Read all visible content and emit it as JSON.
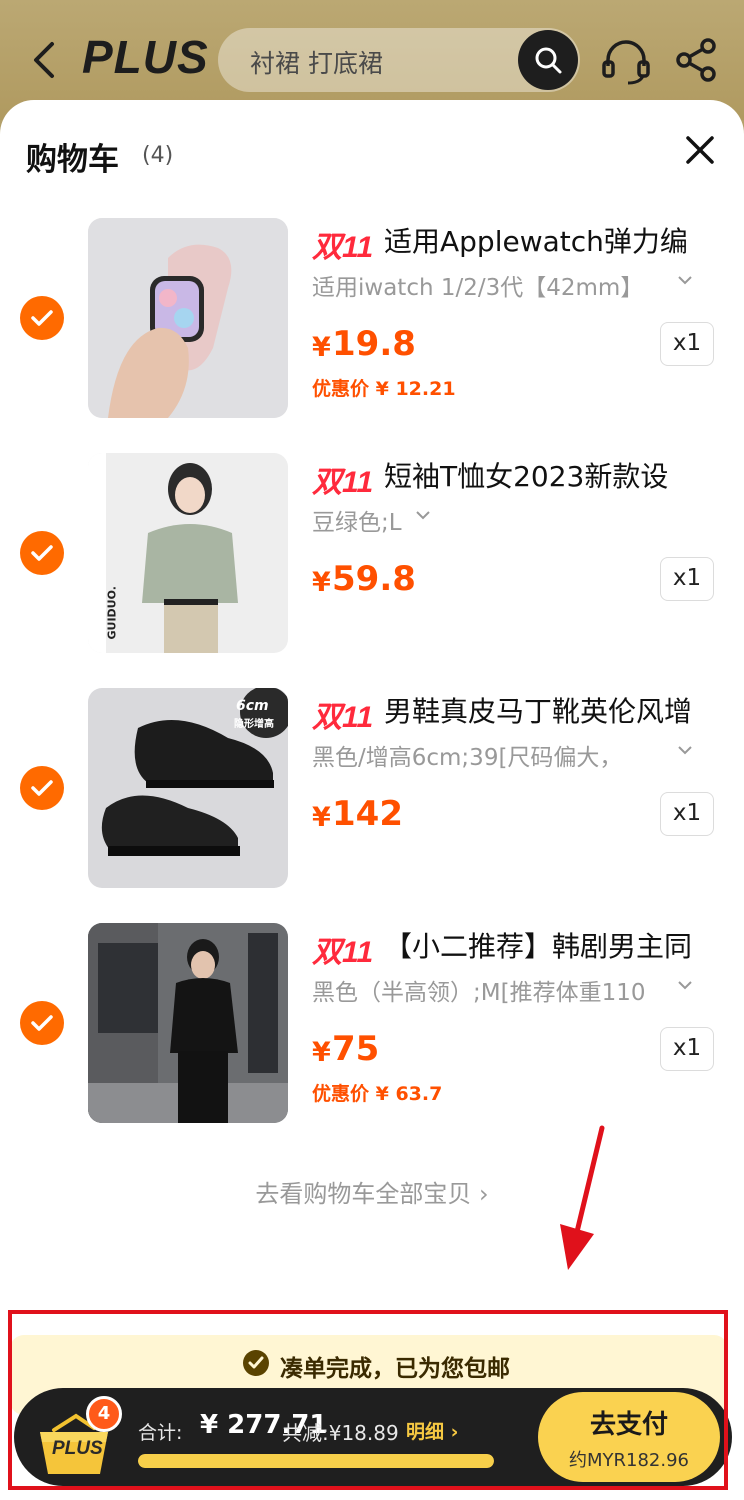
{
  "header": {
    "brand": "PLUS",
    "search_text": "衬裙 打底裙"
  },
  "cart": {
    "title": "购物车",
    "count": "(4)",
    "items": [
      {
        "promo": "双11",
        "title": "适用Applewatch弹力编",
        "spec": "适用iwatch 1/2/3代【42mm】",
        "price_yen": "¥",
        "price": "19.8",
        "discount": "优惠价 ¥ 12.21",
        "qty": "x1",
        "selected": true
      },
      {
        "promo": "双11",
        "title": "短袖T恤女2023新款设",
        "spec": "豆绿色;L",
        "price_yen": "¥",
        "price": "59.8",
        "discount": "",
        "qty": "x1",
        "selected": true,
        "image_text": "GUIDUO."
      },
      {
        "promo": "双11",
        "title": "男鞋真皮马丁靴英伦风增",
        "spec": "黑色/增高6cm;39[尺码偏大，",
        "price_yen": "¥",
        "price": "142",
        "discount": "",
        "qty": "x1",
        "selected": true,
        "image_badge_top": "6cm",
        "image_badge_bottom": "隐形增高"
      },
      {
        "promo": "双11",
        "title": "【小二推荐】韩剧男主同",
        "spec": "黑色（半高领）;M[推荐体重110",
        "price_yen": "¥",
        "price": "75",
        "discount": "优惠价 ¥ 63.7",
        "qty": "x1",
        "selected": true
      }
    ],
    "see_all": "去看购物车全部宝贝 ›"
  },
  "footer": {
    "free_shipping": "凑单完成，已为您包邮",
    "basket_brand": "PLUS",
    "badge_count": "4",
    "total_label": "合计:",
    "total_amount": "¥ 277.71",
    "saved": "共减:¥18.89",
    "detail": "明细 ›",
    "progress": 1.0,
    "pay_label": "去支付",
    "pay_sub": "约MYR182.96"
  },
  "colors": {
    "accent": "#ff5000",
    "promo": "#ff2a3c",
    "check": "#ff6a00",
    "pay_button": "#fad250",
    "highlight": "#e0111b"
  },
  "icons": [
    "back-icon",
    "search-icon",
    "headset-icon",
    "share-icon",
    "close-icon",
    "check-icon",
    "chevron-down-icon",
    "basket-icon"
  ]
}
